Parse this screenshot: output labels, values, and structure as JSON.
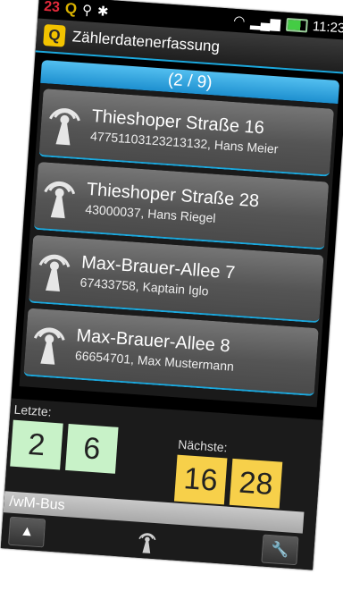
{
  "status_bar": {
    "left_badge": "23",
    "app_badge": "Q",
    "time": "11:23"
  },
  "app": {
    "logo": "Q",
    "title": "Zählerdatenerfassung"
  },
  "list": {
    "header": "(2 / 9)",
    "items": [
      {
        "title": "Thieshoper Straße 16",
        "subtitle": "47751103123213132, Hans Meier",
        "icon": "antenna-icon"
      },
      {
        "title": "Thieshoper Straße 28",
        "subtitle": "43000037, Hans Riegel",
        "icon": "antenna-icon"
      },
      {
        "title": "Max-Brauer-Allee 7",
        "subtitle": "67433758, Kaptain Iglo",
        "icon": "antenna-icon"
      },
      {
        "title": "Max-Brauer-Allee 8",
        "subtitle": "66654701, Max Mustermann",
        "icon": "antenna-icon"
      }
    ]
  },
  "bottom": {
    "last_label": "Letzte:",
    "last_values": [
      "2",
      "6"
    ],
    "next_label": "Nächste:",
    "next_values": [
      "16",
      "28"
    ],
    "bus_label": "/wM-Bus"
  },
  "colors": {
    "accent": "#1ca8dd",
    "last_box": "#c8f2c8",
    "next_box": "#f7d04a"
  }
}
